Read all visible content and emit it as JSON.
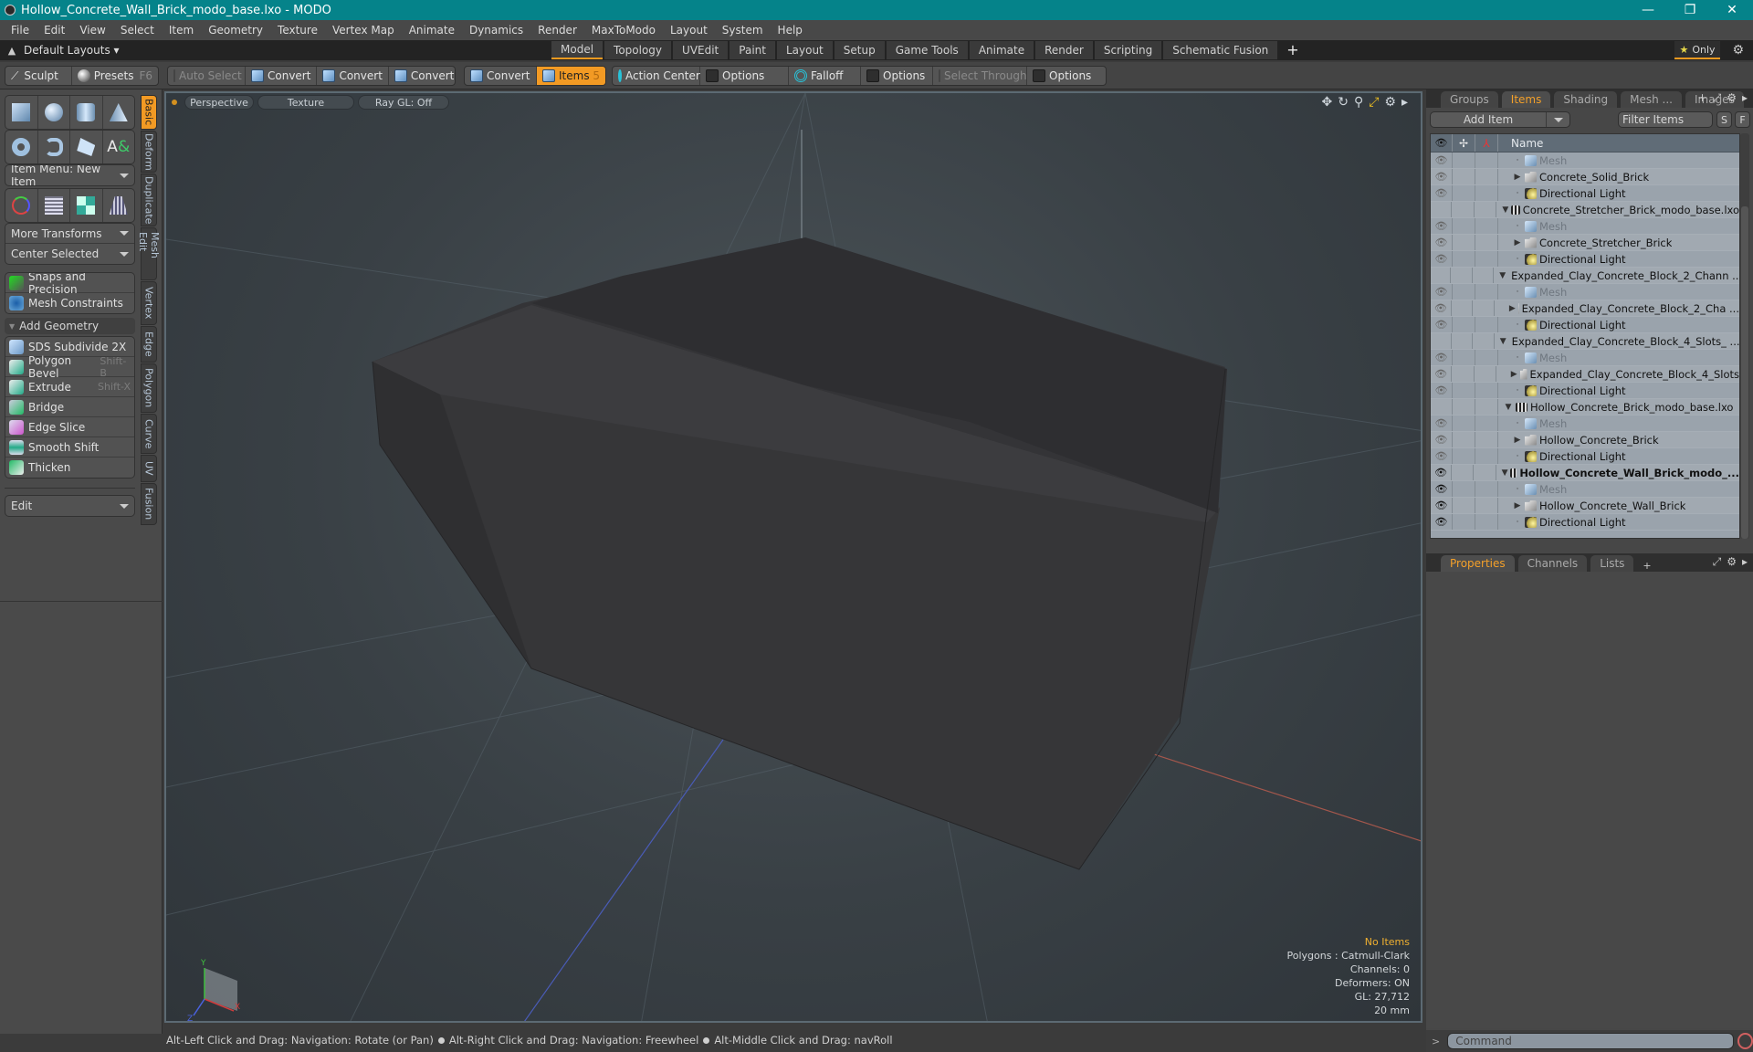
{
  "window": {
    "title": "Hollow_Concrete_Wall_Brick_modo_base.lxo - MODO",
    "controls": [
      "minimize",
      "restore",
      "close"
    ]
  },
  "menu": [
    "File",
    "Edit",
    "View",
    "Select",
    "Item",
    "Geometry",
    "Texture",
    "Vertex Map",
    "Animate",
    "Dynamics",
    "Render",
    "MaxToModo",
    "Layout",
    "System",
    "Help"
  ],
  "layoutbar": {
    "layouts_label": "Default Layouts ▾",
    "tabs": [
      "Model",
      "Topology",
      "UVEdit",
      "Paint",
      "Layout",
      "Setup",
      "Game Tools",
      "Animate",
      "Render",
      "Scripting",
      "Schematic Fusion"
    ],
    "active_tab": "Model",
    "add": "+",
    "only_label": "Only",
    "star": "★"
  },
  "toolbar": {
    "sculpt": "Sculpt",
    "presets": "Presets",
    "presets_key": "F6",
    "auto_select": "Auto Select",
    "convert": [
      "Convert",
      "Convert",
      "Convert",
      "Convert"
    ],
    "items": "Items",
    "items_count": "5",
    "action_center": "Action Center",
    "options1": "Options",
    "falloff": "Falloff",
    "options2": "Options",
    "select_through": "Select Through",
    "options3": "Options"
  },
  "left": {
    "item_menu": "Item Menu: New Item",
    "more_transforms": "More Transforms",
    "center_selected": "Center Selected",
    "snaps": "Snaps and Precision",
    "constraints": "Mesh Constraints",
    "add_geometry": "Add Geometry",
    "geo_tools": [
      {
        "label": "SDS Subdivide 2X",
        "shortcut": ""
      },
      {
        "label": "Polygon Bevel",
        "shortcut": "Shift-B"
      },
      {
        "label": "Extrude",
        "shortcut": "Shift-X"
      },
      {
        "label": "Bridge",
        "shortcut": ""
      },
      {
        "label": "Edge Slice",
        "shortcut": ""
      },
      {
        "label": "Smooth Shift",
        "shortcut": ""
      },
      {
        "label": "Thicken",
        "shortcut": ""
      }
    ],
    "edit": "Edit",
    "vtabs": [
      "Basic",
      "Deform",
      "Duplicate",
      "Mesh Edit",
      "Vertex",
      "Edge",
      "Polygon",
      "Curve",
      "UV",
      "Fusion"
    ],
    "active_vtab": "Basic"
  },
  "viewport": {
    "view": "Perspective",
    "shading": "Texture",
    "raygl": "Ray GL: Off",
    "info": {
      "selection": "No Items",
      "polygons": "Polygons : Catmull-Clark",
      "channels": "Channels: 0",
      "deformers": "Deformers: ON",
      "gl": "GL: 27,712",
      "scale": "20 mm"
    },
    "axis": {
      "x": "X",
      "y": "Y",
      "z": "Z"
    }
  },
  "status": {
    "hints": [
      "Alt-Left Click and Drag: Navigation: Rotate (or Pan)",
      "Alt-Right Click and Drag: Navigation: Freewheel",
      "Alt-Middle Click and Drag: navRoll"
    ]
  },
  "right": {
    "tabs": [
      "Groups",
      "Items",
      "Shading",
      "Mesh ...",
      "Images"
    ],
    "active_tab": "Items",
    "add_item": "Add Item",
    "filter": "Filter Items",
    "s": "S",
    "f": "F",
    "name_header": "Name",
    "rows": [
      {
        "label": "Mesh",
        "type": "mesh",
        "indent": 2,
        "eye": "dim",
        "dim": true
      },
      {
        "label": "Concrete_Solid_Brick",
        "type": "folder",
        "indent": 2,
        "eye": "dim",
        "expander": "▶"
      },
      {
        "label": "Directional Light",
        "type": "light",
        "indent": 2,
        "eye": "dim"
      },
      {
        "label": "Concrete_Stretcher_Brick_modo_base.lxo",
        "type": "scene",
        "indent": 1,
        "eye": "",
        "expander": "▼"
      },
      {
        "label": "Mesh",
        "type": "mesh",
        "indent": 2,
        "eye": "dim",
        "dim": true
      },
      {
        "label": "Concrete_Stretcher_Brick",
        "type": "folder",
        "indent": 2,
        "eye": "dim",
        "expander": "▶"
      },
      {
        "label": "Directional Light",
        "type": "light",
        "indent": 2,
        "eye": "dim"
      },
      {
        "label": "Expanded_Clay_Concrete_Block_2_Chann ...",
        "type": "scene",
        "indent": 1,
        "eye": "",
        "expander": "▼"
      },
      {
        "label": "Mesh",
        "type": "mesh",
        "indent": 2,
        "eye": "dim",
        "dim": true
      },
      {
        "label": "Expanded_Clay_Concrete_Block_2_Cha ...",
        "type": "folder",
        "indent": 2,
        "eye": "dim",
        "expander": "▶"
      },
      {
        "label": "Directional Light",
        "type": "light",
        "indent": 2,
        "eye": "dim"
      },
      {
        "label": "Expanded_Clay_Concrete_Block_4_Slots_ ...",
        "type": "scene",
        "indent": 1,
        "eye": "",
        "expander": "▼"
      },
      {
        "label": "Mesh",
        "type": "mesh",
        "indent": 2,
        "eye": "dim",
        "dim": true
      },
      {
        "label": "Expanded_Clay_Concrete_Block_4_Slots",
        "type": "folder",
        "indent": 2,
        "eye": "dim",
        "expander": "▶"
      },
      {
        "label": "Directional Light",
        "type": "light",
        "indent": 2,
        "eye": "dim"
      },
      {
        "label": "Hollow_Concrete_Brick_modo_base.lxo",
        "type": "scene",
        "indent": 1,
        "eye": "",
        "expander": "▼"
      },
      {
        "label": "Mesh",
        "type": "mesh",
        "indent": 2,
        "eye": "dim",
        "dim": true
      },
      {
        "label": "Hollow_Concrete_Brick",
        "type": "folder",
        "indent": 2,
        "eye": "dim",
        "expander": "▶"
      },
      {
        "label": "Directional Light",
        "type": "light",
        "indent": 2,
        "eye": "dim"
      },
      {
        "label": "Hollow_Concrete_Wall_Brick_modo_...",
        "type": "scene",
        "indent": 1,
        "eye": "on",
        "expander": "▼",
        "bold": true
      },
      {
        "label": "Mesh",
        "type": "mesh",
        "indent": 2,
        "eye": "on",
        "dim": true
      },
      {
        "label": "Hollow_Concrete_Wall_Brick",
        "type": "folder",
        "indent": 2,
        "eye": "on",
        "expander": "▶"
      },
      {
        "label": "Directional Light",
        "type": "light",
        "indent": 2,
        "eye": "on"
      }
    ],
    "bottom_tabs": [
      "Properties",
      "Channels",
      "Lists"
    ],
    "bottom_active": "Properties",
    "command_placeholder": "Command",
    "cmd_prompt": ">"
  },
  "colors": {
    "accent": "#f29a24",
    "title_bar": "#05838a",
    "viewport_border": "#5c6a73",
    "info_warn": "#f0b030"
  }
}
